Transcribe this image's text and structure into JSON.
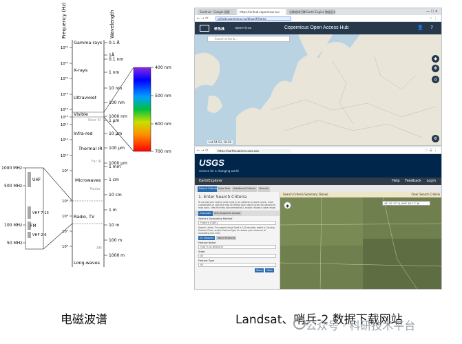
{
  "spectrum": {
    "frequency_axis_label": "Frequency (Hz)",
    "wavelength_axis_label": "Wavelength",
    "frequency_ticks": [
      "10²⁴",
      "10²²",
      "10²⁰",
      "10¹⁸",
      "10¹⁶",
      "10¹⁵",
      "10¹⁴",
      "10¹²",
      "10¹⁰",
      "10⁸",
      "10⁶",
      "10⁴",
      "10²",
      "10⁰"
    ],
    "wavelength_ticks": [
      "0.1 Å",
      "1Å",
      "0.1 nm",
      "1 nm",
      "10 nm",
      "100 nm",
      "1000 nm",
      "1 μm",
      "10 μm",
      "100 μm",
      "1000 μm",
      "1 mm",
      "1 cm",
      "10 cm",
      "1 m",
      "10 m",
      "100 m",
      "1000 m"
    ],
    "bands": [
      "Gamma-rays",
      "X-rays",
      "Ultraviolet",
      "Visible",
      "Near IR",
      "Infra-red",
      "Thermal IR",
      "Far IR",
      "Microwaves",
      "Radar",
      "Radio, TV",
      "AM",
      "Long-waves"
    ],
    "visible_scale": [
      "400 nm",
      "500 nm",
      "600 nm",
      "700 nm"
    ],
    "radio_detail": {
      "freq_labels": [
        "1000 MHz",
        "500 MHz",
        "100 MHz",
        "50 MHz"
      ],
      "bands": [
        "UHF",
        "VHF 7-13",
        "FM",
        "VHF 2-6"
      ]
    },
    "colors": {
      "visible_top": "#8a2be2",
      "visible_bottom": "#ff0000"
    }
  },
  "screenshot_esa": {
    "tabs": [
      "Sentinel - Google 搜索",
      "https://scihub.copernicus.eu/",
      "谷歌地球引擎 Earth Engine 数据目录"
    ],
    "url": "scihub.copernicus.eu/dhus/#/home",
    "logo": "esa",
    "sublogo": "opernicus",
    "hub_title": "Copernicus Open Access Hub",
    "search_placeholder": "Search criteria...",
    "scale_text": "Lat 54.53, 18.28"
  },
  "screenshot_usgs": {
    "url": "https://earthexplorer.usgs.gov",
    "logo": "USGS",
    "tagline": "science for a changing world",
    "app_title": "EarthExplorer",
    "header_links": [
      "Help",
      "Feedback",
      "Login"
    ],
    "tabs": [
      "Search Criteria",
      "Data Sets",
      "Additional Criteria",
      "Results"
    ],
    "summary_label": "Search Criteria Summary (Show)",
    "clear_label": "Clear Search Criteria",
    "panel_heading": "1. Enter Search Criteria",
    "panel_text": "To narrow your search area: type in an address or place name, enter coordinates or click the map to define your search area (for advanced map tools, view the help documentation), and/or choose a date range.",
    "subtabs": [
      "Geocoder",
      "KML/Shapefile Upload"
    ],
    "method_label": "Select a Geocoding Method",
    "method_value": "Feature (GNIS)",
    "limits_text": "Search Limits: The search result limit is 100 records; select a Country, Feature Class, and/or Feature Type to reduce your chances of exceeding this limit.",
    "feature_buttons": [
      "US Features",
      "World Features"
    ],
    "feature_name_label": "Feature Name",
    "feature_name_placeholder": "(use % as wildcard)",
    "state_label": "State",
    "state_value": "All",
    "feature_type_label": "Feature Type",
    "feature_type_value": "All",
    "action_buttons": [
      "Show",
      "Clear"
    ],
    "coord_value": "43° 30' 57\" N, 096° 38' 17\" W"
  },
  "captions": {
    "left": "电磁波谱",
    "right": "Landsat、哨兵-2 数据下载网站"
  },
  "watermark": "公众号 · 科研技术平台"
}
